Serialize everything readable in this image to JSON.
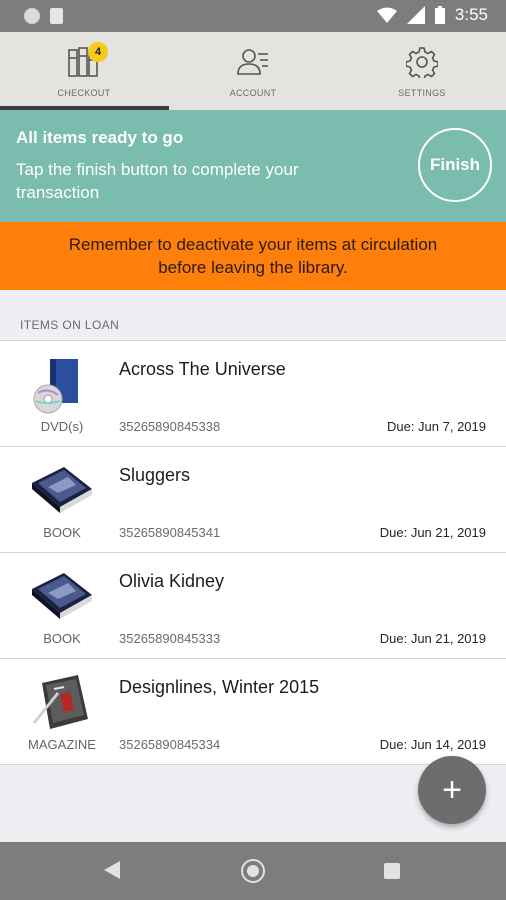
{
  "status_bar": {
    "time": "3:55"
  },
  "tabs": [
    {
      "label": "CHECKOUT",
      "icon": "books-icon",
      "badge": "4",
      "active": true
    },
    {
      "label": "ACCOUNT",
      "icon": "account-icon",
      "active": false
    },
    {
      "label": "SETTINGS",
      "icon": "gear-icon",
      "active": false
    }
  ],
  "ready_banner": {
    "title": "All items ready to go",
    "description": "Tap the finish button to complete your transaction",
    "finish_label": "Finish",
    "color": "#7abcad"
  },
  "warning_banner": {
    "line1": "Remember to deactivate your items at circulation",
    "line2": "before leaving the library.",
    "color": "#ff7f0c"
  },
  "section_header": "ITEMS ON LOAN",
  "items": [
    {
      "title": "Across The Universe",
      "format": "DVD(s)",
      "barcode": "35265890845338",
      "due": "Due: Jun 7, 2019",
      "icon": "dvd-icon"
    },
    {
      "title": "Sluggers",
      "format": "BOOK",
      "barcode": "35265890845341",
      "due": "Due: Jun 21, 2019",
      "icon": "book-icon"
    },
    {
      "title": "Olivia Kidney",
      "format": "BOOK",
      "barcode": "35265890845333",
      "due": "Due: Jun 21, 2019",
      "icon": "book-icon"
    },
    {
      "title": "Designlines, Winter 2015",
      "format": "MAGAZINE",
      "barcode": "35265890845334",
      "due": "Due: Jun 14, 2019",
      "icon": "magazine-icon"
    }
  ],
  "fab": {
    "label": "+"
  }
}
